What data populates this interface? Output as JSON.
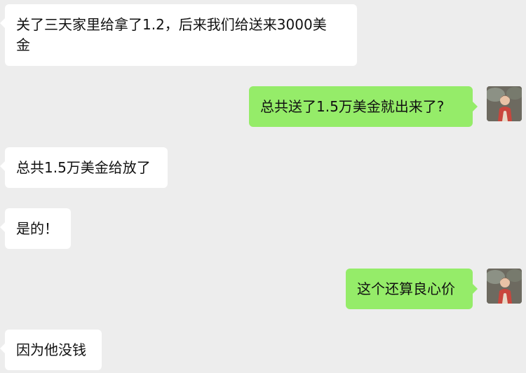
{
  "chat": {
    "messages": [
      {
        "side": "incoming",
        "text": "关了三天家里给拿了1.2，后来我们给送来3000美\n金"
      },
      {
        "side": "outgoing",
        "text": "总共送了1.5万美金就出来了?",
        "avatar": "user-avatar-icon"
      },
      {
        "side": "incoming",
        "text": "总共1.5万美金给放了"
      },
      {
        "side": "incoming",
        "text": "是的！"
      },
      {
        "side": "outgoing",
        "text": "这个还算良心价",
        "avatar": "user-avatar-icon"
      },
      {
        "side": "incoming",
        "text": "因为他没钱"
      }
    ]
  },
  "colors": {
    "background": "#ededed",
    "incoming_bubble": "#ffffff",
    "outgoing_bubble": "#95ec69",
    "text": "#111111"
  }
}
